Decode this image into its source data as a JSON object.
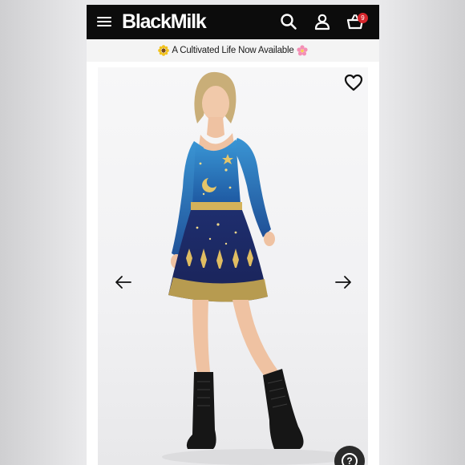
{
  "header": {
    "brand": "BlackMilk",
    "cart_count": "9",
    "icons": [
      "hamburger-icon",
      "search-icon",
      "account-icon",
      "basket-icon"
    ]
  },
  "promo": {
    "text": "A Cultivated Life Now Available",
    "left_icon": "sunflower-emoji",
    "right_icon": "pink-flower-emoji"
  },
  "product": {
    "image_alt": "Model wearing a blue celestial print long-sleeve skater dress with black combat boots",
    "wishlist_icon": "heart-icon",
    "prev_icon": "arrow-left-icon",
    "next_icon": "arrow-right-icon"
  },
  "help": {
    "label": "?"
  },
  "colors": {
    "topbar": "#0c0c0c",
    "badge": "#d6262c",
    "promo_bg": "#f4f4f4",
    "dress_top": "#2e7fc4",
    "dress_skirt": "#1b2a66",
    "gold": "#d4b25a"
  }
}
